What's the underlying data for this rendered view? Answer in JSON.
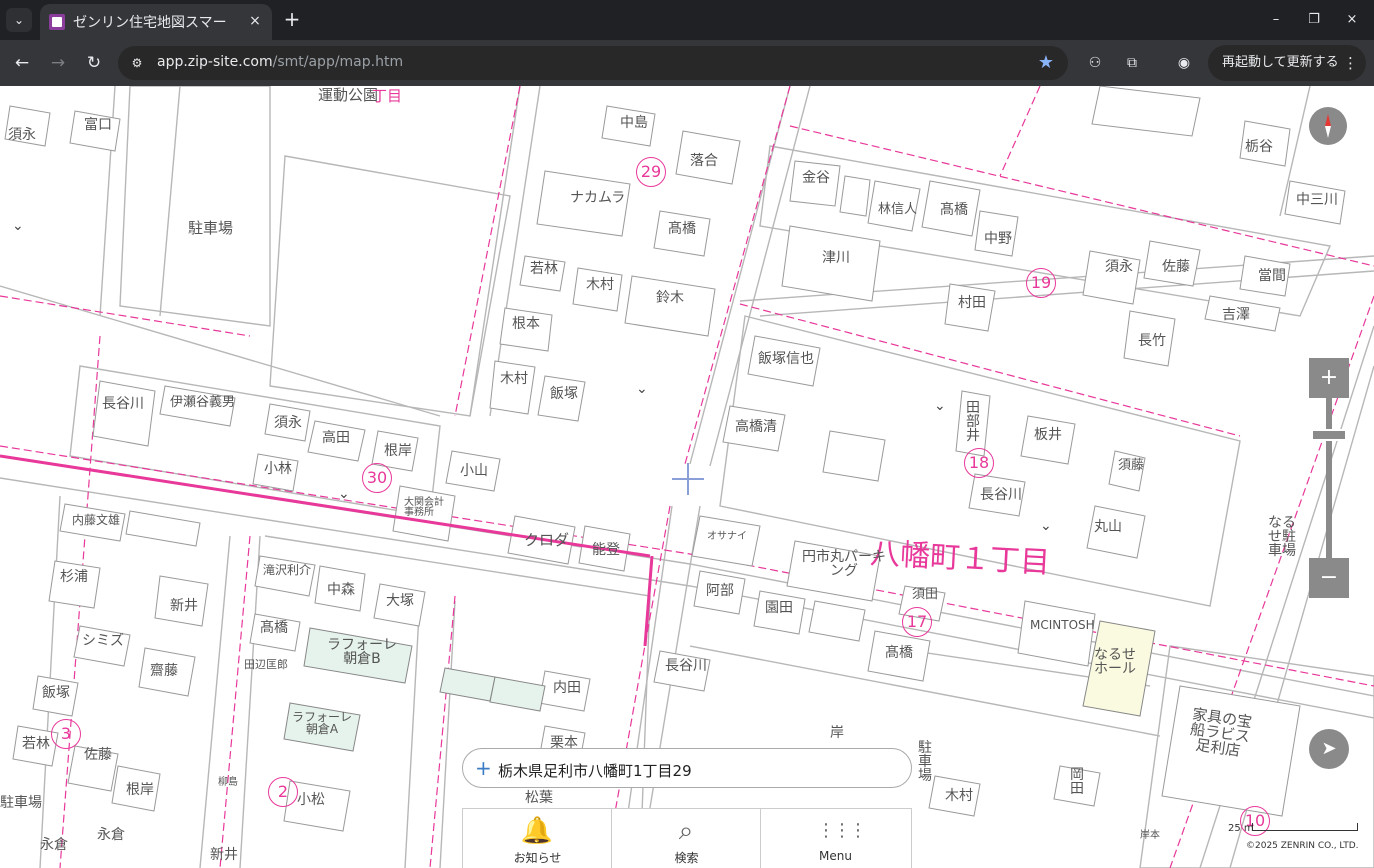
{
  "browser": {
    "tab_list_icon": "chevron-down-icon",
    "tab_title": "ゼンリン住宅地図スマー",
    "tab_close": "×",
    "new_tab": "+",
    "window": {
      "minimize": "–",
      "restore": "❐",
      "close": "×"
    },
    "nav": {
      "back": "←",
      "forward": "→",
      "reload": "↻"
    },
    "url_host": "app.zip-site.com",
    "url_path": "/smt/app/map.htm",
    "bookmark_icon": "★",
    "relaunch_label": "再起動して更新する",
    "relaunch_menu": "⋮"
  },
  "map": {
    "town_label": "八幡町１丁目",
    "top_label": "運動公園",
    "top_label2": "丁目",
    "block_numbers": [
      "29",
      "30",
      "19",
      "18",
      "17",
      "3",
      "2",
      "10"
    ],
    "buildings": [
      "中島",
      "落合",
      "ナカムラ",
      "髙橋",
      "若林",
      "木村",
      "鈴木",
      "根本",
      "木村",
      "飯塚",
      "金谷",
      "林信人",
      "髙橋",
      "中野",
      "津川",
      "須永",
      "佐藤",
      "當間",
      "吉澤",
      "中三川",
      "栃谷",
      "村田",
      "長竹",
      "飯塚信也",
      "高橋清",
      "田部井",
      "板井",
      "長谷川",
      "丸山",
      "須藤",
      "長谷川",
      "伊瀬谷義男",
      "須永",
      "高田",
      "根岸",
      "小林",
      "小山",
      "大関会計事務所",
      "クロダ",
      "能登",
      "内藤文雄",
      "杉浦",
      "新井",
      "シミズ",
      "齋藤",
      "飯塚",
      "若林",
      "佐藤",
      "根岸",
      "滝沢利介",
      "中森",
      "大塚",
      "髙橋",
      "ラフォーレ朝倉B",
      "ラフォーレ朝倉A",
      "小松",
      "内田",
      "栗本",
      "松葉",
      "オサナイ",
      "阿部",
      "園田",
      "円市丸パーキング",
      "須田",
      "髙橋",
      "MCINTOSH",
      "なるせホール",
      "長谷川",
      "岸",
      "駐車場",
      "木村",
      "岡田",
      "家具の宝船ラビス足利店",
      "駐車場",
      "富口",
      "須永",
      "永倉",
      "永倉",
      "新井",
      "田辺匡郎",
      "駐車場",
      "なるせ駐車場",
      "柳島",
      "岸本"
    ],
    "compass_icon": "compass-icon",
    "zoom_in": "+",
    "zoom_out": "−",
    "locate_icon": "navigation-arrow-icon",
    "address_text": "栃木県足利市八幡町1丁目29",
    "address_plus": "+",
    "bottom_nav": [
      {
        "label": "お知らせ",
        "icon": "bell-icon",
        "glyph": "🔔"
      },
      {
        "label": "検索",
        "icon": "search-icon",
        "glyph": "⌕"
      },
      {
        "label": "Menu",
        "icon": "grid-icon",
        "glyph": "⋮⋮⋮"
      }
    ],
    "scale_label": "25 m",
    "copyright": "©2025 ZENRIN CO., LTD."
  }
}
